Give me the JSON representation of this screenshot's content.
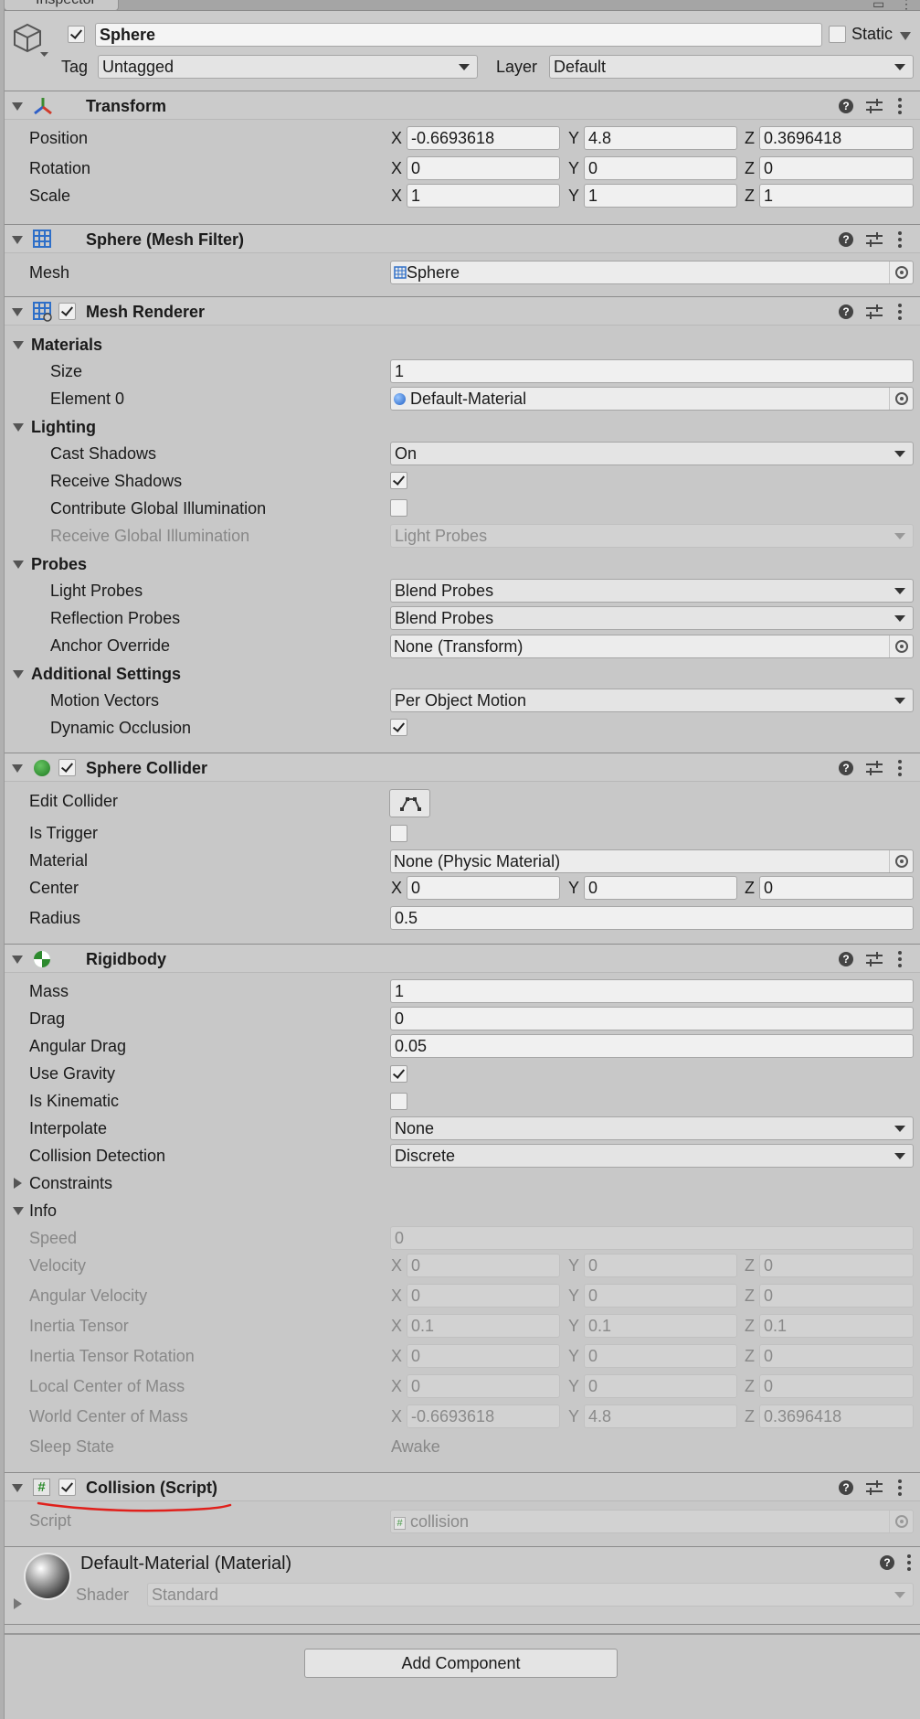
{
  "window": {
    "tab_title": "Inspector"
  },
  "gameobject": {
    "enabled": true,
    "name": "Sphere",
    "static_label": "Static",
    "tag_label": "Tag",
    "tag_value": "Untagged",
    "layer_label": "Layer",
    "layer_value": "Default"
  },
  "transform": {
    "title": "Transform",
    "position": {
      "label": "Position",
      "x": "-0.6693618",
      "y": "4.8",
      "z": "0.3696418"
    },
    "rotation": {
      "label": "Rotation",
      "x": "0",
      "y": "0",
      "z": "0"
    },
    "scale": {
      "label": "Scale",
      "x": "1",
      "y": "1",
      "z": "1"
    }
  },
  "axes": {
    "x": "X",
    "y": "Y",
    "z": "Z"
  },
  "mesh_filter": {
    "title": "Sphere (Mesh Filter)",
    "mesh_label": "Mesh",
    "mesh_value": "Sphere"
  },
  "mesh_renderer": {
    "title": "Mesh Renderer",
    "enabled": true,
    "materials": {
      "label": "Materials",
      "size_label": "Size",
      "size_value": "1",
      "element0_label": "Element 0",
      "element0_value": "Default-Material"
    },
    "lighting": {
      "label": "Lighting",
      "cast_shadows_label": "Cast Shadows",
      "cast_shadows_value": "On",
      "receive_shadows_label": "Receive Shadows",
      "receive_shadows": true,
      "contribute_gi_label": "Contribute Global Illumination",
      "contribute_gi": false,
      "receive_gi_label": "Receive Global Illumination",
      "receive_gi_value": "Light Probes"
    },
    "probes": {
      "label": "Probes",
      "light_probes_label": "Light Probes",
      "light_probes_value": "Blend Probes",
      "reflection_probes_label": "Reflection Probes",
      "reflection_probes_value": "Blend Probes",
      "anchor_override_label": "Anchor Override",
      "anchor_override_value": "None (Transform)"
    },
    "additional": {
      "label": "Additional Settings",
      "motion_vectors_label": "Motion Vectors",
      "motion_vectors_value": "Per Object Motion",
      "dynamic_occlusion_label": "Dynamic Occlusion",
      "dynamic_occlusion": true
    }
  },
  "sphere_collider": {
    "title": "Sphere Collider",
    "enabled": true,
    "edit_collider_label": "Edit Collider",
    "is_trigger_label": "Is Trigger",
    "is_trigger": false,
    "material_label": "Material",
    "material_value": "None (Physic Material)",
    "center_label": "Center",
    "center": {
      "x": "0",
      "y": "0",
      "z": "0"
    },
    "radius_label": "Radius",
    "radius_value": "0.5"
  },
  "rigidbody": {
    "title": "Rigidbody",
    "mass_label": "Mass",
    "mass_value": "1",
    "drag_label": "Drag",
    "drag_value": "0",
    "angular_drag_label": "Angular Drag",
    "angular_drag_value": "0.05",
    "use_gravity_label": "Use Gravity",
    "use_gravity": true,
    "is_kinematic_label": "Is Kinematic",
    "is_kinematic": false,
    "interpolate_label": "Interpolate",
    "interpolate_value": "None",
    "collision_detection_label": "Collision Detection",
    "collision_detection_value": "Discrete",
    "constraints_label": "Constraints",
    "info": {
      "label": "Info",
      "speed_label": "Speed",
      "speed_value": "0",
      "velocity_label": "Velocity",
      "velocity": {
        "x": "0",
        "y": "0",
        "z": "0"
      },
      "angular_velocity_label": "Angular Velocity",
      "angular_velocity": {
        "x": "0",
        "y": "0",
        "z": "0"
      },
      "inertia_tensor_label": "Inertia Tensor",
      "inertia_tensor": {
        "x": "0.1",
        "y": "0.1",
        "z": "0.1"
      },
      "inertia_tensor_rotation_label": "Inertia Tensor Rotation",
      "inertia_tensor_rotation": {
        "x": "0",
        "y": "0",
        "z": "0"
      },
      "local_com_label": "Local Center of Mass",
      "local_com": {
        "x": "0",
        "y": "0",
        "z": "0"
      },
      "world_com_label": "World Center of Mass",
      "world_com": {
        "x": "-0.6693618",
        "y": "4.8",
        "z": "0.3696418"
      },
      "sleep_state_label": "Sleep State",
      "sleep_state_value": "Awake"
    }
  },
  "collision_script": {
    "title": "Collision (Script)",
    "enabled": true,
    "script_label": "Script",
    "script_value": "collision",
    "annotation_color": "#e0201b"
  },
  "material_preview": {
    "title": "Default-Material (Material)",
    "shader_label": "Shader",
    "shader_value": "Standard"
  },
  "add_component": {
    "label": "Add Component"
  }
}
